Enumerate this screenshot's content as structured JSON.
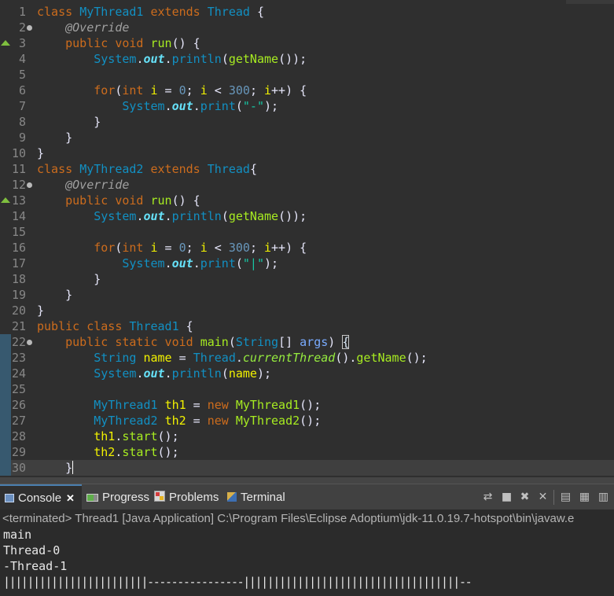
{
  "editor": {
    "lines": [
      {
        "n": "1",
        "tokens": [
          [
            "kw",
            "class "
          ],
          [
            "cls",
            "MyThread1"
          ],
          [
            "kw",
            " extends "
          ],
          [
            "cls",
            "Thread"
          ],
          [
            "op",
            " {"
          ]
        ]
      },
      {
        "n": "2",
        "fold": true,
        "tokens": [
          [
            "op",
            "    "
          ],
          [
            "ann",
            "@Override"
          ]
        ]
      },
      {
        "n": "3",
        "marker": true,
        "tokens": [
          [
            "op",
            "    "
          ],
          [
            "kw",
            "public void "
          ],
          [
            "mth",
            "run"
          ],
          [
            "op",
            "() {"
          ]
        ]
      },
      {
        "n": "4",
        "tokens": [
          [
            "op",
            "        "
          ],
          [
            "cls",
            "System"
          ],
          [
            "op",
            "."
          ],
          [
            "fld",
            "out"
          ],
          [
            "op",
            "."
          ],
          [
            "cls",
            "println"
          ],
          [
            "op",
            "("
          ],
          [
            "mth",
            "getName"
          ],
          [
            "op",
            "());"
          ]
        ]
      },
      {
        "n": "5",
        "tokens": []
      },
      {
        "n": "6",
        "tokens": [
          [
            "op",
            "        "
          ],
          [
            "kw",
            "for"
          ],
          [
            "op",
            "("
          ],
          [
            "kw",
            "int "
          ],
          [
            "var",
            "i"
          ],
          [
            "op",
            " = "
          ],
          [
            "num",
            "0"
          ],
          [
            "op",
            "; "
          ],
          [
            "var",
            "i"
          ],
          [
            "op",
            " < "
          ],
          [
            "num",
            "300"
          ],
          [
            "op",
            "; "
          ],
          [
            "var",
            "i"
          ],
          [
            "op",
            "++) {"
          ]
        ]
      },
      {
        "n": "7",
        "tokens": [
          [
            "op",
            "            "
          ],
          [
            "cls",
            "System"
          ],
          [
            "op",
            "."
          ],
          [
            "fld",
            "out"
          ],
          [
            "op",
            "."
          ],
          [
            "cls",
            "print"
          ],
          [
            "op",
            "("
          ],
          [
            "str",
            "\"-\""
          ],
          [
            "op",
            ");"
          ]
        ]
      },
      {
        "n": "8",
        "tokens": [
          [
            "op",
            "        }"
          ]
        ]
      },
      {
        "n": "9",
        "tokens": [
          [
            "op",
            "    }"
          ]
        ]
      },
      {
        "n": "10",
        "tokens": [
          [
            "op",
            "}"
          ]
        ]
      },
      {
        "n": "11",
        "tokens": [
          [
            "kw",
            "class "
          ],
          [
            "cls",
            "MyThread2"
          ],
          [
            "kw",
            " extends "
          ],
          [
            "cls",
            "Thread"
          ],
          [
            "op",
            "{"
          ]
        ]
      },
      {
        "n": "12",
        "fold": true,
        "tokens": [
          [
            "op",
            "    "
          ],
          [
            "ann",
            "@Override"
          ]
        ]
      },
      {
        "n": "13",
        "marker": true,
        "tokens": [
          [
            "op",
            "    "
          ],
          [
            "kw",
            "public void "
          ],
          [
            "mth",
            "run"
          ],
          [
            "op",
            "() {"
          ]
        ]
      },
      {
        "n": "14",
        "tokens": [
          [
            "op",
            "        "
          ],
          [
            "cls",
            "System"
          ],
          [
            "op",
            "."
          ],
          [
            "fld",
            "out"
          ],
          [
            "op",
            "."
          ],
          [
            "cls",
            "println"
          ],
          [
            "op",
            "("
          ],
          [
            "mth",
            "getName"
          ],
          [
            "op",
            "());"
          ]
        ]
      },
      {
        "n": "15",
        "tokens": []
      },
      {
        "n": "16",
        "tokens": [
          [
            "op",
            "        "
          ],
          [
            "kw",
            "for"
          ],
          [
            "op",
            "("
          ],
          [
            "kw",
            "int "
          ],
          [
            "var",
            "i"
          ],
          [
            "op",
            " = "
          ],
          [
            "num",
            "0"
          ],
          [
            "op",
            "; "
          ],
          [
            "var",
            "i"
          ],
          [
            "op",
            " < "
          ],
          [
            "num",
            "300"
          ],
          [
            "op",
            "; "
          ],
          [
            "var",
            "i"
          ],
          [
            "op",
            "++) {"
          ]
        ]
      },
      {
        "n": "17",
        "tokens": [
          [
            "op",
            "            "
          ],
          [
            "cls",
            "System"
          ],
          [
            "op",
            "."
          ],
          [
            "fld",
            "out"
          ],
          [
            "op",
            "."
          ],
          [
            "cls",
            "print"
          ],
          [
            "op",
            "("
          ],
          [
            "str",
            "\"|\""
          ],
          [
            "op",
            ");"
          ]
        ]
      },
      {
        "n": "18",
        "tokens": [
          [
            "op",
            "        }"
          ]
        ]
      },
      {
        "n": "19",
        "tokens": [
          [
            "op",
            "    }"
          ]
        ]
      },
      {
        "n": "20",
        "tokens": [
          [
            "op",
            "}"
          ]
        ]
      },
      {
        "n": "21",
        "tokens": [
          [
            "kw",
            "public class "
          ],
          [
            "cls",
            "Thread1"
          ],
          [
            "op",
            " {"
          ]
        ]
      },
      {
        "n": "22",
        "fold": true,
        "sel": true,
        "tokens": [
          [
            "op",
            "    "
          ],
          [
            "kw",
            "public static void "
          ],
          [
            "mth",
            "main"
          ],
          [
            "op",
            "("
          ],
          [
            "cls",
            "String"
          ],
          [
            "op",
            "[] "
          ],
          [
            "par",
            "args"
          ],
          [
            "op",
            ") "
          ],
          [
            "bracket",
            "{"
          ]
        ]
      },
      {
        "n": "23",
        "sel": true,
        "tokens": [
          [
            "op",
            "        "
          ],
          [
            "cls",
            "String"
          ],
          [
            "op",
            " "
          ],
          [
            "var",
            "name"
          ],
          [
            "op",
            " = "
          ],
          [
            "cls",
            "Thread"
          ],
          [
            "op",
            "."
          ],
          [
            "smeth",
            "currentThread"
          ],
          [
            "op",
            "()."
          ],
          [
            "mth",
            "getName"
          ],
          [
            "op",
            "();"
          ]
        ]
      },
      {
        "n": "24",
        "sel": true,
        "tokens": [
          [
            "op",
            "        "
          ],
          [
            "cls",
            "System"
          ],
          [
            "op",
            "."
          ],
          [
            "fld",
            "out"
          ],
          [
            "op",
            "."
          ],
          [
            "cls",
            "println"
          ],
          [
            "op",
            "("
          ],
          [
            "var",
            "name"
          ],
          [
            "op",
            ");"
          ]
        ]
      },
      {
        "n": "25",
        "sel": true,
        "tokens": []
      },
      {
        "n": "26",
        "sel": true,
        "tokens": [
          [
            "op",
            "        "
          ],
          [
            "cls",
            "MyThread1"
          ],
          [
            "op",
            " "
          ],
          [
            "var",
            "th1"
          ],
          [
            "op",
            " = "
          ],
          [
            "kw",
            "new "
          ],
          [
            "mth",
            "MyThread1"
          ],
          [
            "op",
            "();"
          ]
        ]
      },
      {
        "n": "27",
        "sel": true,
        "tokens": [
          [
            "op",
            "        "
          ],
          [
            "cls",
            "MyThread2"
          ],
          [
            "op",
            " "
          ],
          [
            "var",
            "th2"
          ],
          [
            "op",
            " = "
          ],
          [
            "kw",
            "new "
          ],
          [
            "mth",
            "MyThread2"
          ],
          [
            "op",
            "();"
          ]
        ]
      },
      {
        "n": "28",
        "sel": true,
        "tokens": [
          [
            "op",
            "        "
          ],
          [
            "var",
            "th1"
          ],
          [
            "op",
            "."
          ],
          [
            "mth",
            "start"
          ],
          [
            "op",
            "();"
          ]
        ]
      },
      {
        "n": "29",
        "sel": true,
        "tokens": [
          [
            "op",
            "        "
          ],
          [
            "var",
            "th2"
          ],
          [
            "op",
            "."
          ],
          [
            "mth",
            "start"
          ],
          [
            "op",
            "();"
          ]
        ]
      },
      {
        "n": "30",
        "sel": true,
        "current": true,
        "tokens": [
          [
            "op",
            "    }"
          ]
        ]
      }
    ]
  },
  "views": {
    "tabs": [
      {
        "label": "Console",
        "icon": "console-icon",
        "active": true
      },
      {
        "label": "Progress",
        "icon": "progress-icon",
        "active": false
      },
      {
        "label": "Problems",
        "icon": "problems-icon",
        "active": false
      },
      {
        "label": "Terminal",
        "icon": "terminal-icon",
        "active": false
      }
    ],
    "toolbar_icons": [
      "sync-icon",
      "stop-icon",
      "remove-launch-icon",
      "remove-all-terminated-icon",
      "scroll-lock-icon",
      "word-wrap-icon",
      "pin-console-icon"
    ]
  },
  "console": {
    "header": "<terminated> Thread1 [Java Application] C:\\Program Files\\Eclipse Adoptium\\jdk-11.0.19.7-hotspot\\bin\\javaw.e",
    "output": [
      "main",
      "Thread-0",
      "-Thread-1",
      "||||||||||||||||||||||||----------------||||||||||||||||||||||||||||||||||||--"
    ]
  }
}
